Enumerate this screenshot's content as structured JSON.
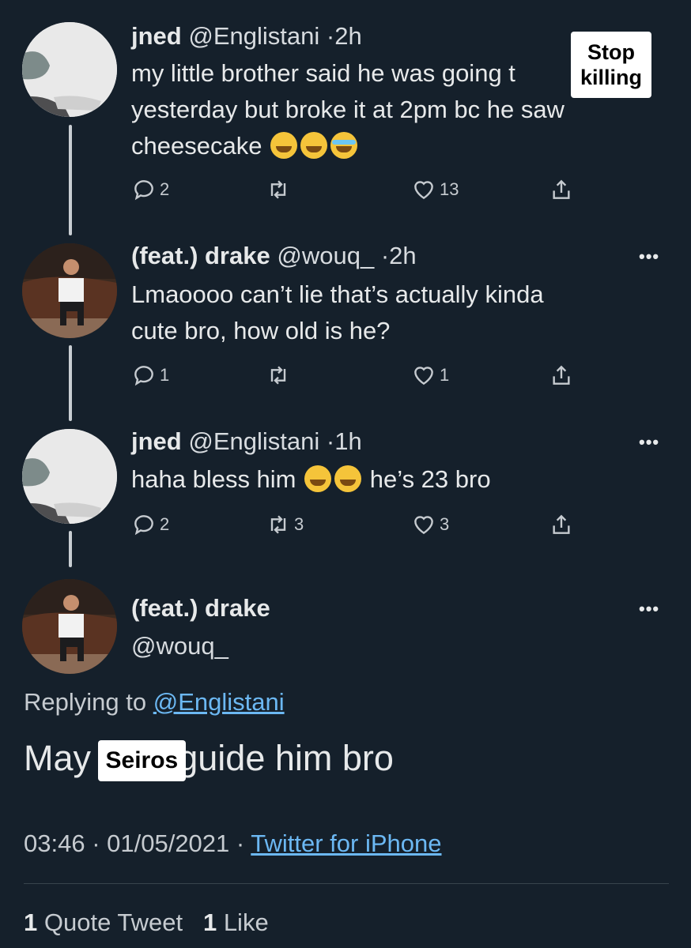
{
  "tweets": [
    {
      "name": "jned",
      "handle": "@Englistani",
      "time": "2h",
      "text_line1": "my little brother said he was going t",
      "text_line2": "yesterday but broke it at 2pm bc he saw",
      "text_line3": "cheesecake",
      "replies": "2",
      "retweets": "",
      "likes": "13"
    },
    {
      "name": "(feat.) drake",
      "handle": "@wouq_",
      "time": "2h",
      "text_line1": "Lmaoooo can’t lie that’s actually kinda",
      "text_line2": "cute bro, how old is he?",
      "replies": "1",
      "retweets": "",
      "likes": "1"
    },
    {
      "name": "jned",
      "handle": "@Englistani",
      "time": "1h",
      "text_before": "haha bless him",
      "text_after": "he’s 23 bro",
      "replies": "2",
      "retweets": "3",
      "likes": "3"
    }
  ],
  "main": {
    "name": "(feat.) drake",
    "handle": "@wouq_",
    "replying_prefix": "Replying to",
    "replying_handle": "@Englistani",
    "text_before": "May",
    "censor_label": "Seiros",
    "text_after": "guide him bro",
    "timestamp": "03:46 · 01/05/2021 ·",
    "source": "Twitter for iPhone",
    "quote_count": "1",
    "quote_label": "Quote Tweet",
    "like_count": "1",
    "like_label": "Like"
  },
  "overlay_badge": {
    "line1": "Stop",
    "line2": "killing"
  },
  "separator": "·",
  "more_glyph": "•••",
  "icons": [
    "reply-icon",
    "retweet-icon",
    "like-icon",
    "share-icon",
    "more-icon",
    "crying-laughing-emoji",
    "sobbing-emoji"
  ],
  "colors": {
    "background": "#15202b",
    "text": "#e7e9ea",
    "link": "#6cb8f3",
    "icon": "#c6cbd0"
  }
}
